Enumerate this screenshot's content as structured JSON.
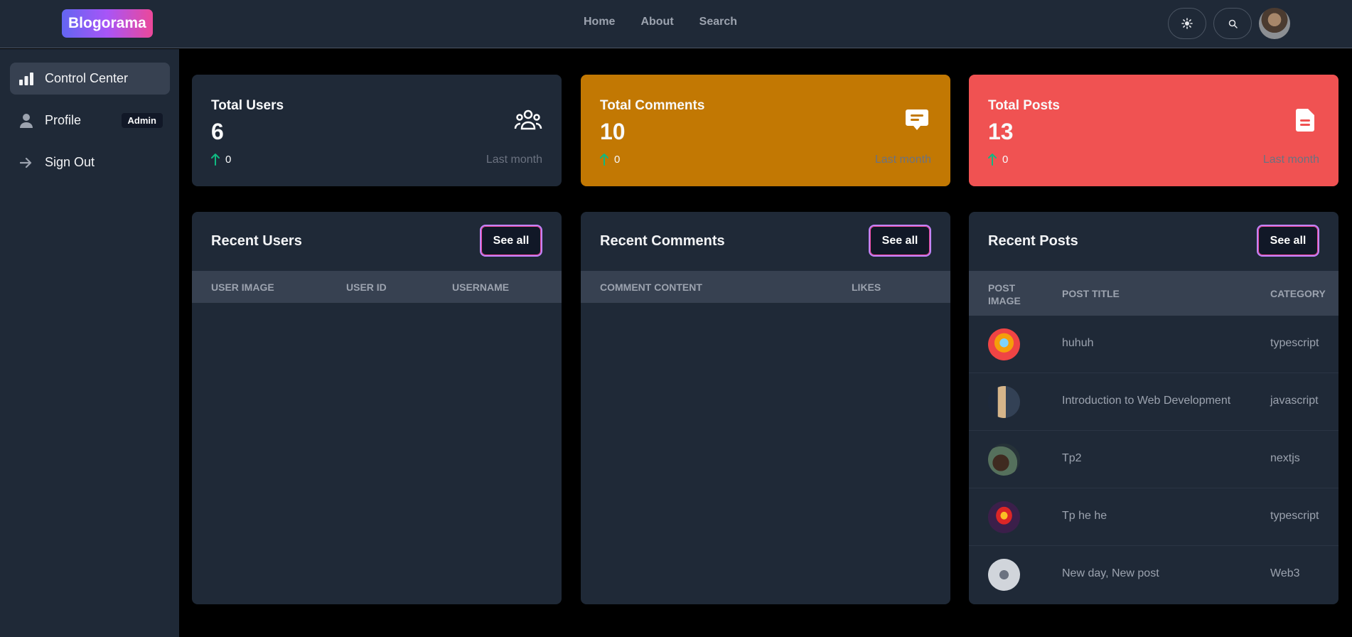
{
  "app": {
    "logo": "Blogorama"
  },
  "nav": {
    "links": [
      "Home",
      "About",
      "Search"
    ]
  },
  "sidebar": {
    "items": [
      {
        "label": "Control Center",
        "icon": "chart-bar-icon",
        "active": true
      },
      {
        "label": "Profile",
        "icon": "user-icon",
        "badge": "Admin"
      },
      {
        "label": "Sign Out",
        "icon": "arrow-right-icon"
      }
    ]
  },
  "stats": [
    {
      "title": "Total Users",
      "value": "6",
      "change": "0",
      "period": "Last month",
      "icon": "users-group-icon",
      "bg": "#1f2937"
    },
    {
      "title": "Total Comments",
      "value": "10",
      "change": "0",
      "period": "Last month",
      "icon": "comment-icon",
      "bg": "#c27803"
    },
    {
      "title": "Total Posts",
      "value": "13",
      "change": "0",
      "period": "Last month",
      "icon": "document-icon",
      "bg": "#f05252"
    }
  ],
  "panels": {
    "users": {
      "title": "Recent Users",
      "see_all": "See all",
      "columns": [
        "User image",
        "User ID",
        "Username"
      ]
    },
    "comments": {
      "title": "Recent Comments",
      "see_all": "See all",
      "columns": [
        "Comment content",
        "Likes"
      ]
    },
    "posts": {
      "title": "Recent Posts",
      "see_all": "See all",
      "columns": [
        "Post image",
        "Post title",
        "Category"
      ],
      "rows": [
        {
          "title": "huhuh",
          "category": "typescript"
        },
        {
          "title": "Introduction to Web Development",
          "category": "javascript"
        },
        {
          "title": "Tp2",
          "category": "nextjs"
        },
        {
          "title": "Tp he he",
          "category": "typescript"
        },
        {
          "title": "New day, New post",
          "category": "Web3"
        }
      ]
    }
  },
  "colors": {
    "accent_up": "#10b981",
    "sidebar_bg": "#1f2937",
    "page_bg": "#000000"
  }
}
